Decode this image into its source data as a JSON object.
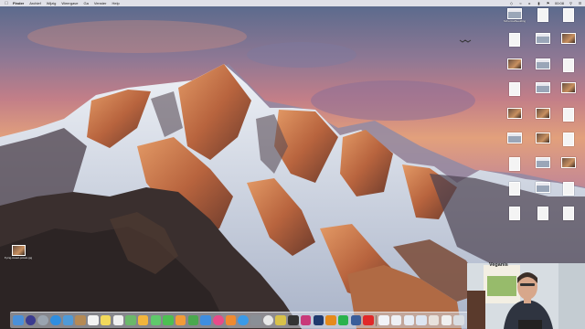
{
  "menubar": {
    "app_name": "Finder",
    "items": [
      "Archief",
      "Wijzig",
      "Weergave",
      "Ga",
      "Venster",
      "Help"
    ],
    "clock": "00:08"
  },
  "desktop": {
    "icons": [
      {
        "label": "Schermafbeelding",
        "kind": "shot",
        "selected": false
      },
      {
        "label": "",
        "kind": "doc",
        "selected": false
      },
      {
        "label": "",
        "kind": "doc",
        "selected": false
      },
      {
        "label": "",
        "kind": "doc",
        "selected": false
      },
      {
        "label": "",
        "kind": "shot",
        "selected": false
      },
      {
        "label": "",
        "kind": "photo",
        "selected": false
      },
      {
        "label": "",
        "kind": "photo",
        "selected": false
      },
      {
        "label": "",
        "kind": "shot",
        "selected": false
      },
      {
        "label": "",
        "kind": "doc",
        "selected": false
      },
      {
        "label": "",
        "kind": "doc",
        "selected": false
      },
      {
        "label": "",
        "kind": "shot",
        "selected": false
      },
      {
        "label": "",
        "kind": "photo",
        "selected": false
      },
      {
        "label": "",
        "kind": "photo",
        "selected": false
      },
      {
        "label": "",
        "kind": "photo",
        "selected": false
      },
      {
        "label": "",
        "kind": "doc",
        "selected": false
      },
      {
        "label": "",
        "kind": "shot",
        "selected": true
      },
      {
        "label": "",
        "kind": "photo",
        "selected": false
      },
      {
        "label": "",
        "kind": "doc",
        "selected": false
      },
      {
        "label": "",
        "kind": "doc",
        "selected": false
      },
      {
        "label": "",
        "kind": "shot",
        "selected": false
      },
      {
        "label": "",
        "kind": "photo",
        "selected": false
      },
      {
        "label": "",
        "kind": "doc",
        "selected": false
      },
      {
        "label": "",
        "kind": "shot",
        "selected": false
      },
      {
        "label": "",
        "kind": "doc",
        "selected": false
      },
      {
        "label": "",
        "kind": "doc",
        "selected": false
      },
      {
        "label": "",
        "kind": "doc",
        "selected": false
      },
      {
        "label": "",
        "kind": "doc",
        "selected": false
      }
    ],
    "left_icon": {
      "label": "frying-sweet-potato.jpg",
      "kind": "photo"
    }
  },
  "dock": {
    "apps": [
      {
        "name": "finder-icon",
        "color": "#4a90d9"
      },
      {
        "name": "siri-icon",
        "color": "#3b3b8f"
      },
      {
        "name": "launchpad-icon",
        "color": "#9aa4b0"
      },
      {
        "name": "safari-icon",
        "color": "#2f8ee0"
      },
      {
        "name": "mail-icon",
        "color": "#4f9ad8"
      },
      {
        "name": "contacts-icon",
        "color": "#b58a55"
      },
      {
        "name": "calendar-icon",
        "color": "#f4f4f4"
      },
      {
        "name": "notes-icon",
        "color": "#f2d95c"
      },
      {
        "name": "reminders-icon",
        "color": "#f0f0f0"
      },
      {
        "name": "maps-icon",
        "color": "#6bb86a"
      },
      {
        "name": "photos-icon",
        "color": "#f2b53c"
      },
      {
        "name": "messages-icon",
        "color": "#5fc96b"
      },
      {
        "name": "facetime-icon",
        "color": "#4cbf52"
      },
      {
        "name": "pages-icon",
        "color": "#f29b38"
      },
      {
        "name": "numbers-icon",
        "color": "#4aa84e"
      },
      {
        "name": "keynote-icon",
        "color": "#3f8ee0"
      },
      {
        "name": "itunes-icon",
        "color": "#e84b8a"
      },
      {
        "name": "ibooks-icon",
        "color": "#f08a2f"
      },
      {
        "name": "appstore-icon",
        "color": "#3a9ae8"
      },
      {
        "name": "preferences-icon",
        "color": "#8a8f96"
      },
      {
        "name": "chrome-icon",
        "color": "#e8e8e8"
      },
      {
        "name": "sketch-icon",
        "color": "#d8c14a"
      },
      {
        "name": "camera-icon",
        "color": "#333333"
      },
      {
        "name": "indesign-icon",
        "color": "#c83a7a"
      },
      {
        "name": "photoshop-icon",
        "color": "#1f3a6e"
      },
      {
        "name": "illustrator-icon",
        "color": "#e58a1c"
      },
      {
        "name": "spotify-icon",
        "color": "#2ab24c"
      },
      {
        "name": "lightroom-icon",
        "color": "#3a5e9a"
      },
      {
        "name": "acrobat-icon",
        "color": "#e02828"
      }
    ],
    "stacks": [
      {
        "name": "documents-stack-icon",
        "color": "#f2f4f8"
      },
      {
        "name": "downloads-stack-icon",
        "color": "#eef0f4"
      },
      {
        "name": "screenshots-stack-icon",
        "color": "#e6ecf4"
      },
      {
        "name": "folder-stack-icon",
        "color": "#dde6f2"
      },
      {
        "name": "photos-stack-icon",
        "color": "#e8e2dc"
      },
      {
        "name": "files-stack-icon",
        "color": "#f0f0f0"
      },
      {
        "name": "trash-icon",
        "color": "#d9dde2"
      }
    ]
  },
  "webcam": {
    "sign_text": "Veganis"
  },
  "colors": {
    "sky_top": "#5a6e8e",
    "sky_mid": "#c07a8a",
    "sky_low": "#e7a27a",
    "rock_dark": "#3b3030",
    "rock_lit": "#d98a5c",
    "snow": "#dfe4ec",
    "selection": "#2f6fd6"
  }
}
